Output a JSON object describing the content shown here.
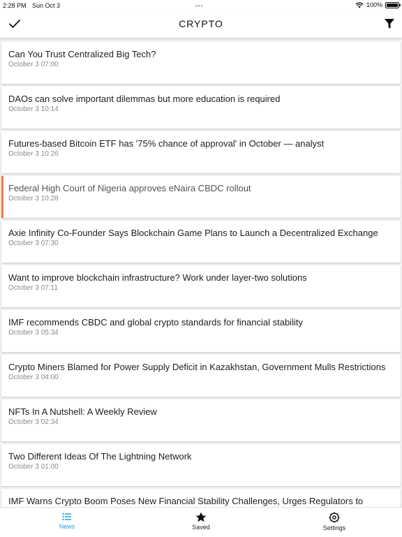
{
  "status_bar": {
    "time": "2:28 PM",
    "date": "Sun Oct 3",
    "battery": "100%"
  },
  "header": {
    "title": "CRYPTO"
  },
  "articles": [
    {
      "title": "Can You Trust Centralized Big Tech?",
      "time": "October 3 07:00"
    },
    {
      "title": "DAOs can solve important dilemmas but more education is required",
      "time": "October 3 10:14"
    },
    {
      "title": "Futures-based Bitcoin ETF has '75% chance of approval' in October — analyst",
      "time": "October 3 10:26"
    },
    {
      "title": "Federal High Court of Nigeria approves eNaira CBDC rollout",
      "time": "October 3 10:28",
      "active": true
    },
    {
      "title": "Axie Infinity Co-Founder Says Blockchain Game Plans to Launch a Decentralized Exchange",
      "time": "October 3 07:30"
    },
    {
      "title": "Want to improve blockchain infrastructure? Work under layer-two solutions",
      "time": "October 3 07:11"
    },
    {
      "title": "IMF recommends CBDC and global crypto standards for financial stability",
      "time": "October 3 05:34"
    },
    {
      "title": "Crypto Miners Blamed for Power Supply Deficit in Kazakhstan, Government Mulls Restrictions",
      "time": "October 3 04:00"
    },
    {
      "title": "NFTs In A Nutshell: A Weekly Review",
      "time": "October 3 02:34"
    },
    {
      "title": "Two Different Ideas Of The Lightning Network",
      "time": "October 3 01:00"
    },
    {
      "title": "IMF Warns Crypto Boom Poses New Financial Stability Challenges, Urges Regulators to",
      "time": ""
    }
  ],
  "tabs": [
    {
      "label": "News",
      "icon": "news-icon",
      "selected": true
    },
    {
      "label": "Saved",
      "icon": "star-icon"
    },
    {
      "label": "Settings",
      "icon": "gear-icon"
    }
  ],
  "colors": {
    "accent": "#2f9fe0",
    "active_marker": "#f07c3a"
  }
}
